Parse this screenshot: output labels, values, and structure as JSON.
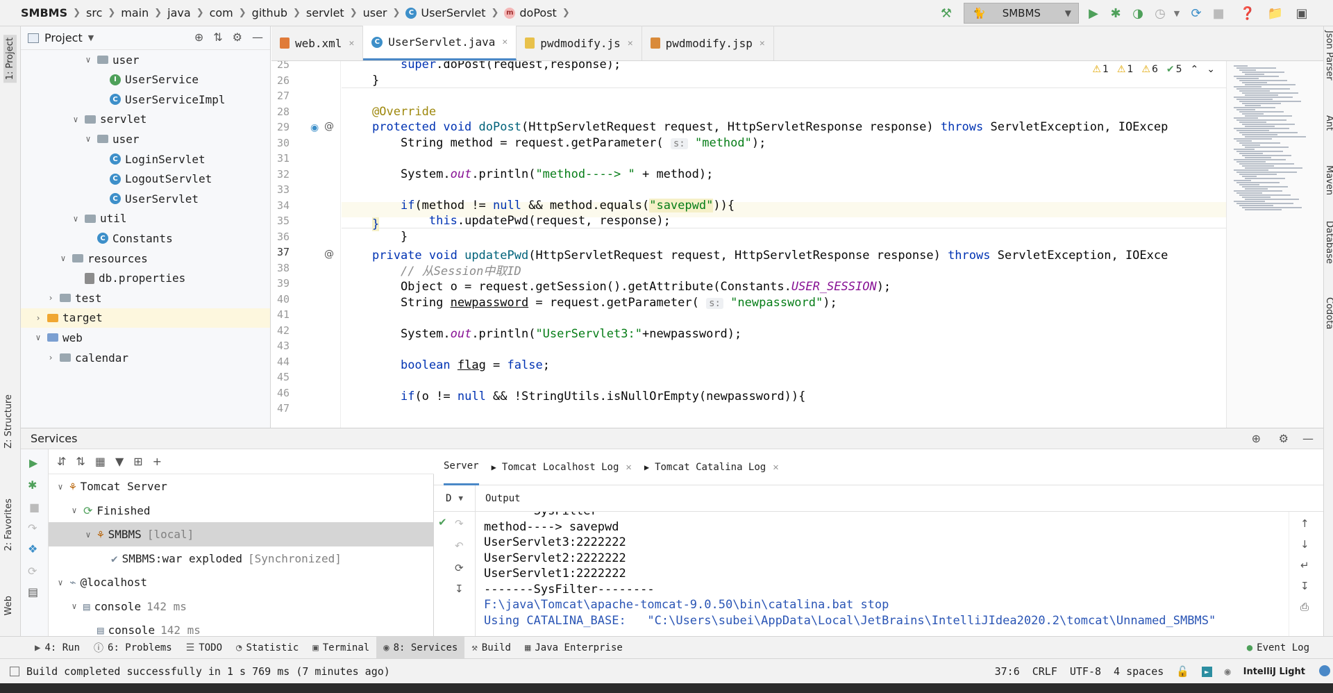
{
  "breadcrumbs": [
    "SMBMS",
    "src",
    "main",
    "java",
    "com",
    "github",
    "servlet",
    "user",
    "UserServlet",
    "doPost"
  ],
  "run_config": {
    "name": "SMBMS"
  },
  "project": {
    "title": "Project",
    "tree": [
      {
        "label": "user",
        "kind": "folder",
        "indent": 4,
        "expanded": true
      },
      {
        "label": "UserService",
        "kind": "interface",
        "indent": 5
      },
      {
        "label": "UserServiceImpl",
        "kind": "class",
        "indent": 5
      },
      {
        "label": "servlet",
        "kind": "folder",
        "indent": 3,
        "expanded": true
      },
      {
        "label": "user",
        "kind": "folder",
        "indent": 4,
        "expanded": true
      },
      {
        "label": "LoginServlet",
        "kind": "class",
        "indent": 5
      },
      {
        "label": "LogoutServlet",
        "kind": "class",
        "indent": 5
      },
      {
        "label": "UserServlet",
        "kind": "class",
        "indent": 5
      },
      {
        "label": "util",
        "kind": "folder",
        "indent": 3,
        "expanded": true
      },
      {
        "label": "Constants",
        "kind": "class",
        "indent": 4
      },
      {
        "label": "resources",
        "kind": "folder",
        "indent": 2,
        "expanded": true
      },
      {
        "label": "db.properties",
        "kind": "props",
        "indent": 3
      },
      {
        "label": "test",
        "kind": "folder",
        "indent": 1,
        "expanded": false
      },
      {
        "label": "target",
        "kind": "folder-orange",
        "indent": 0,
        "expanded": false
      },
      {
        "label": "web",
        "kind": "folder-web",
        "indent": 0,
        "expanded": true
      },
      {
        "label": "calendar",
        "kind": "folder",
        "indent": 1,
        "expanded": false
      }
    ]
  },
  "editor": {
    "tabs": [
      {
        "label": "web.xml",
        "icon": "xml-file-icon",
        "active": false
      },
      {
        "label": "UserServlet.java",
        "icon": "java-class-icon",
        "active": true
      },
      {
        "label": "pwdmodify.js",
        "icon": "js-file-icon",
        "active": false
      },
      {
        "label": "pwdmodify.jsp",
        "icon": "jsp-file-icon",
        "active": false
      }
    ],
    "inspections": {
      "warn_a": "1",
      "warn_b": "1",
      "warn_c": "6",
      "ok": "5"
    },
    "line_numbers": [
      "25",
      "26",
      "27",
      "28",
      "29",
      "30",
      "31",
      "32",
      "33",
      "34",
      "35",
      "36",
      "37",
      "38",
      "39",
      "40",
      "41",
      "42",
      "43",
      "44",
      "45",
      "46",
      "47"
    ],
    "current_line": "37"
  },
  "services": {
    "title": "Services",
    "tree": [
      {
        "label": "Tomcat Server",
        "suffix": "",
        "indent": 0
      },
      {
        "label": "Finished",
        "suffix": "",
        "indent": 1
      },
      {
        "label": "SMBMS",
        "suffix": "[local]",
        "indent": 2,
        "selected": true
      },
      {
        "label": "SMBMS:war exploded",
        "suffix": "[Synchronized]",
        "indent": 3
      },
      {
        "label": "@localhost",
        "suffix": "",
        "indent": 0
      },
      {
        "label": "console",
        "suffix": "142 ms",
        "indent": 1
      },
      {
        "label": "console",
        "suffix": "142 ms",
        "indent": 2
      }
    ],
    "tabs": [
      {
        "label": "Server",
        "active": true
      },
      {
        "label": "Tomcat Localhost Log",
        "active": false
      },
      {
        "label": "Tomcat Catalina Log",
        "active": false
      }
    ],
    "dropdown": "D",
    "output_label": "Output",
    "output_lines": [
      {
        "text": "-------SysFilter--------",
        "style": "normal"
      },
      {
        "text": "method----> savepwd",
        "style": "normal"
      },
      {
        "text": "UserServlet3:2222222",
        "style": "normal"
      },
      {
        "text": "UserServlet2:2222222",
        "style": "normal"
      },
      {
        "text": "UserServlet1:2222222",
        "style": "normal"
      },
      {
        "text": "-------SysFilter--------",
        "style": "normal"
      },
      {
        "text": "F:\\java\\Tomcat\\apache-tomcat-9.0.50\\bin\\catalina.bat stop",
        "style": "blue"
      },
      {
        "text": "Using CATALINA_BASE:   \"C:\\Users\\subei\\AppData\\Local\\JetBrains\\IntelliJIdea2020.2\\tomcat\\Unnamed_SMBMS\"",
        "style": "blue"
      }
    ]
  },
  "bottom_tools": [
    {
      "label": "4: Run",
      "icon": "run-icon"
    },
    {
      "label": "6: Problems",
      "icon": "problems-icon"
    },
    {
      "label": "TODO",
      "icon": "todo-icon"
    },
    {
      "label": "Statistic",
      "icon": "statistic-icon"
    },
    {
      "label": "Terminal",
      "icon": "terminal-icon"
    },
    {
      "label": "8: Services",
      "icon": "services-icon",
      "active": true
    },
    {
      "label": "Build",
      "icon": "build-icon"
    },
    {
      "label": "Java Enterprise",
      "icon": "java-enterprise-icon"
    }
  ],
  "event_log": "Event Log",
  "status": {
    "message": "Build completed successfully in 1 s 769 ms (7 minutes ago)",
    "position": "37:6",
    "line_sep": "CRLF",
    "encoding": "UTF-8",
    "indent": "4 spaces",
    "theme": "IntelliJ Light"
  },
  "side_tabs": {
    "left": [
      "1: Project",
      "Z: Structure",
      "2: Favorites",
      "Web"
    ],
    "right": [
      "Json Parser",
      "Ant",
      "Maven",
      "Database",
      "Codota"
    ]
  },
  "colors": {
    "accent": "#4a88c7",
    "keyword": "#0033b3",
    "string": "#067d17",
    "annotation": "#9e880d"
  }
}
